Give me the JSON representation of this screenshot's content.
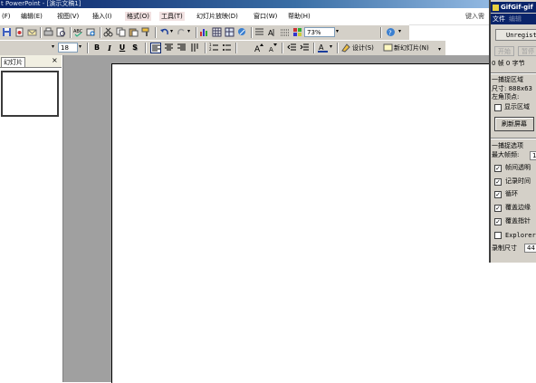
{
  "window": {
    "title": "t PowerPoint - [演示文稿1]"
  },
  "menubar": {
    "items": [
      {
        "label": "(F)"
      },
      {
        "label": "编辑(E)"
      },
      {
        "label": "视图(V)"
      },
      {
        "label": "插入(I)"
      },
      {
        "label": "格式(O)"
      },
      {
        "label": "工具(T)"
      },
      {
        "label": "幻灯片放映(D)"
      },
      {
        "label": "窗口(W)"
      },
      {
        "label": "帮助(H)"
      }
    ],
    "help_hint": "键入需"
  },
  "standard_toolbar": {
    "zoom": "73%"
  },
  "formatting_toolbar": {
    "font_size": "18",
    "bold": "B",
    "italic": "I",
    "underline": "U",
    "shadow": "S",
    "font_color_glyph": "A",
    "design_label": "设计(S)",
    "new_slide_label": "新幻灯片(N)"
  },
  "left_pane": {
    "tab_label": "幻灯片",
    "close": "×"
  },
  "gifgif": {
    "title": "GifGif-gif",
    "menu": [
      "文件",
      "编辑"
    ],
    "unregistered": "Unregiste",
    "buttons": [
      "开始",
      "暂停"
    ],
    "stats": "0 帧 0 字节",
    "capture_area_header": "一捕捉区域",
    "size_label": "尺寸: 888x63",
    "top_left_label": "左角顶点:",
    "show_area_label": "显示区域",
    "refresh_label": "刷新屏幕",
    "capture_options_header": "一捕捉选项",
    "max_fps_label": "最大帧频:",
    "max_fps_value": "1",
    "options": [
      {
        "label": "帧间透明",
        "checked": true
      },
      {
        "label": "记录时间",
        "checked": true
      },
      {
        "label": "循环",
        "checked": true
      },
      {
        "label": "覆盖边缘",
        "checked": true
      },
      {
        "label": "覆盖指针",
        "checked": true
      },
      {
        "label": "Explorer",
        "checked": false
      }
    ],
    "record_size_label": "录制尺寸",
    "record_size_value": "44"
  }
}
